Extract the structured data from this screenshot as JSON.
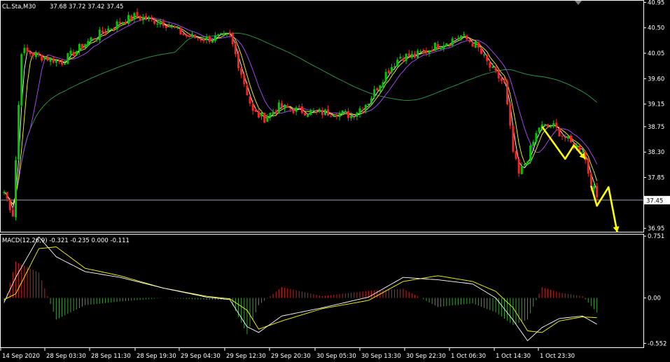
{
  "header": {
    "symbol": "CL.Sta,M30",
    "ohlc": "37.68 37.72 37.42 37.45"
  },
  "colors": {
    "background": "#000000",
    "frame": "#ffffff",
    "bull": "#00c800",
    "bear": "#ff2020",
    "ma_fast": "#ffffff",
    "ma_mid": "#ffff00",
    "ma_slow": "#b24cff",
    "ma_long": "#2e9e4c",
    "bid_line": "#a8b8c8",
    "arrow": "#ffff00",
    "macd_signal": "#ffff00",
    "macd_line": "#ffffff",
    "hist_pos": "#cc2020",
    "hist_neg": "#3aa03a"
  },
  "price_panel": {
    "ymin": 36.89,
    "ymax": 40.98,
    "ticks": [
      "40.95",
      "40.50",
      "40.05",
      "39.60",
      "39.15",
      "38.75",
      "38.30",
      "37.85",
      "37.45",
      "36.95"
    ],
    "current_price": "37.45",
    "current_price_value": 37.45
  },
  "macd_panel": {
    "label": "MACD(12,26,9) -0.321 -0.235 0.000 -0.111",
    "ymin": -0.6,
    "ymax": 0.77,
    "ticks": [
      "0.751",
      "0.00",
      "-0.552"
    ]
  },
  "x_axis": {
    "labels": [
      "14 Sep 2020",
      "28 Sep 03:30",
      "28 Sep 11:30",
      "28 Sep 19:30",
      "29 Sep 04:30",
      "29 Sep 12:30",
      "29 Sep 20:30",
      "30 Sep 05:30",
      "30 Sep 13:30",
      "30 Sep 22:30",
      "1 Oct 06:30",
      "1 Oct 14:30",
      "1 Oct 23:30"
    ]
  },
  "chart_data": [
    {
      "type": "candlestick",
      "symbol": "CL.Sta",
      "timeframe": "M30",
      "anchors": [
        {
          "bar": 0,
          "price": 37.6
        },
        {
          "bar": 3,
          "price": 37.2
        },
        {
          "bar": 6,
          "price": 40.1
        },
        {
          "bar": 12,
          "price": 40.0
        },
        {
          "bar": 20,
          "price": 39.9
        },
        {
          "bar": 30,
          "price": 40.3
        },
        {
          "bar": 40,
          "price": 40.6
        },
        {
          "bar": 45,
          "price": 40.7
        },
        {
          "bar": 55,
          "price": 40.6
        },
        {
          "bar": 63,
          "price": 40.35
        },
        {
          "bar": 70,
          "price": 40.3
        },
        {
          "bar": 78,
          "price": 40.35
        },
        {
          "bar": 82,
          "price": 39.7
        },
        {
          "bar": 86,
          "price": 39.0
        },
        {
          "bar": 90,
          "price": 38.9
        },
        {
          "bar": 95,
          "price": 39.1
        },
        {
          "bar": 100,
          "price": 39.05
        },
        {
          "bar": 108,
          "price": 39.0
        },
        {
          "bar": 115,
          "price": 39.0
        },
        {
          "bar": 120,
          "price": 38.95
        },
        {
          "bar": 126,
          "price": 39.2
        },
        {
          "bar": 132,
          "price": 39.7
        },
        {
          "bar": 137,
          "price": 40.0
        },
        {
          "bar": 142,
          "price": 40.0
        },
        {
          "bar": 150,
          "price": 40.2
        },
        {
          "bar": 158,
          "price": 40.35
        },
        {
          "bar": 163,
          "price": 40.2
        },
        {
          "bar": 168,
          "price": 39.8
        },
        {
          "bar": 173,
          "price": 39.5
        },
        {
          "bar": 176,
          "price": 38.3
        },
        {
          "bar": 178,
          "price": 37.9
        },
        {
          "bar": 181,
          "price": 38.2
        },
        {
          "bar": 185,
          "price": 38.75
        },
        {
          "bar": 190,
          "price": 38.75
        },
        {
          "bar": 196,
          "price": 38.45
        },
        {
          "bar": 200,
          "price": 38.35
        },
        {
          "bar": 203,
          "price": 37.75
        },
        {
          "bar": 205,
          "price": 37.5
        }
      ],
      "moving_averages": [
        "white (fast)",
        "yellow",
        "purple",
        "green (long)"
      ],
      "annotation": "yellow zigzag projection arrows"
    },
    {
      "type": "macd",
      "params": "12,26,9",
      "values": {
        "macd": -0.321,
        "signal": -0.235,
        "hist_zero": 0.0,
        "osma": -0.111
      },
      "anchors": [
        {
          "bar": 0,
          "main": -0.05,
          "signal": -0.02
        },
        {
          "bar": 4,
          "main": 0.25,
          "signal": 0.05
        },
        {
          "bar": 12,
          "main": 0.74,
          "signal": 0.6
        },
        {
          "bar": 18,
          "main": 0.5,
          "signal": 0.62
        },
        {
          "bar": 28,
          "main": 0.32,
          "signal": 0.36
        },
        {
          "bar": 40,
          "main": 0.25,
          "signal": 0.27
        },
        {
          "bar": 55,
          "main": 0.12,
          "signal": 0.12
        },
        {
          "bar": 70,
          "main": 0.01,
          "signal": 0.02
        },
        {
          "bar": 78,
          "main": -0.02,
          "signal": -0.01
        },
        {
          "bar": 84,
          "main": -0.35,
          "signal": -0.15
        },
        {
          "bar": 88,
          "main": -0.42,
          "signal": -0.38
        },
        {
          "bar": 96,
          "main": -0.22,
          "signal": -0.28
        },
        {
          "bar": 110,
          "main": -0.12,
          "signal": -0.13
        },
        {
          "bar": 126,
          "main": 0.01,
          "signal": -0.03
        },
        {
          "bar": 138,
          "main": 0.25,
          "signal": 0.2
        },
        {
          "bar": 150,
          "main": 0.22,
          "signal": 0.27
        },
        {
          "bar": 162,
          "main": 0.17,
          "signal": 0.2
        },
        {
          "bar": 170,
          "main": 0.0,
          "signal": 0.08
        },
        {
          "bar": 176,
          "main": -0.27,
          "signal": -0.12
        },
        {
          "bar": 181,
          "main": -0.52,
          "signal": -0.4
        },
        {
          "bar": 186,
          "main": -0.36,
          "signal": -0.42
        },
        {
          "bar": 192,
          "main": -0.25,
          "signal": -0.28
        },
        {
          "bar": 200,
          "main": -0.22,
          "signal": -0.23
        },
        {
          "bar": 205,
          "main": -0.32,
          "signal": -0.24
        }
      ]
    }
  ]
}
